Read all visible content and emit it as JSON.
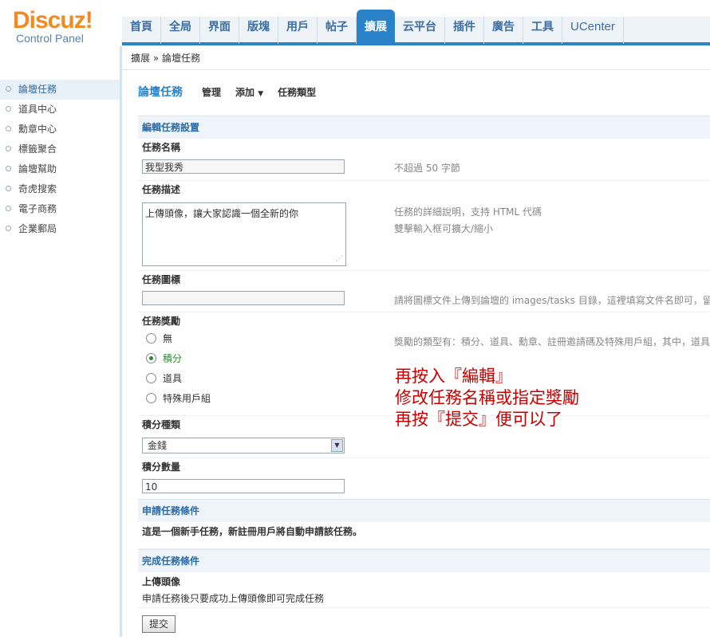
{
  "logo": {
    "main": "Discuz!",
    "sub": "Control Panel"
  },
  "nav": [
    {
      "label": "首頁"
    },
    {
      "label": "全局"
    },
    {
      "label": "界面"
    },
    {
      "label": "版塊"
    },
    {
      "label": "用戶"
    },
    {
      "label": "帖子"
    },
    {
      "label": "擴展"
    },
    {
      "label": "云平台"
    },
    {
      "label": "插件"
    },
    {
      "label": "廣告"
    },
    {
      "label": "工具"
    },
    {
      "label": "UCenter"
    }
  ],
  "breadcrumb": "擴展 » 論壇任務",
  "sidebar": [
    {
      "label": "論壇任務"
    },
    {
      "label": "道具中心"
    },
    {
      "label": "勳章中心"
    },
    {
      "label": "標籤聚合"
    },
    {
      "label": "論壇幫助"
    },
    {
      "label": "奇虎搜索"
    },
    {
      "label": "電子商務"
    },
    {
      "label": "企業郵局"
    }
  ],
  "tabs": {
    "title": "論壇任務",
    "manage": "管理",
    "add": "添加",
    "types": "任務類型"
  },
  "form": {
    "section_edit": "編輯任務設置",
    "name_label": "任務名稱",
    "name_value": "我型我秀",
    "name_tip": "不超過 50 字節",
    "desc_label": "任務描述",
    "desc_value": "上傳頭像，讓大家認識一個全新的你",
    "desc_tip1": "任務的詳細說明，支持 HTML 代碼",
    "desc_tip2": "雙擊輸入框可擴大/縮小",
    "icon_label": "任務圖標",
    "icon_value": "",
    "icon_tip": "請將圖標文件上傳到論壇的 images/tasks 目錄，這裡填寫文件名即可，留",
    "reward_label": "任務獎勵",
    "reward_tip": "獎勵的類型有：積分、道具、勳章、註冊邀請碼及特殊用戶組，其中，道具",
    "reward_options": [
      "無",
      "積分",
      "道具",
      "特殊用戶組"
    ],
    "reward_selected": "積分",
    "credit_type_label": "積分種類",
    "credit_type_value": "金錢",
    "credit_amount_label": "積分數量",
    "credit_amount_value": "10",
    "section_apply": "申請任務條件",
    "apply_text": "這是一個新手任務，新註冊用戶將自動申請該任務。",
    "section_complete": "完成任務條件",
    "complete_label": "上傳頭像",
    "complete_text": "申請任務後只要成功上傳頭像即可完成任務",
    "submit_label": "提交"
  },
  "annotation": [
    "再按入『編輯』",
    "修改任務名稱或指定獎勵",
    "再按『提交』便可以了"
  ]
}
